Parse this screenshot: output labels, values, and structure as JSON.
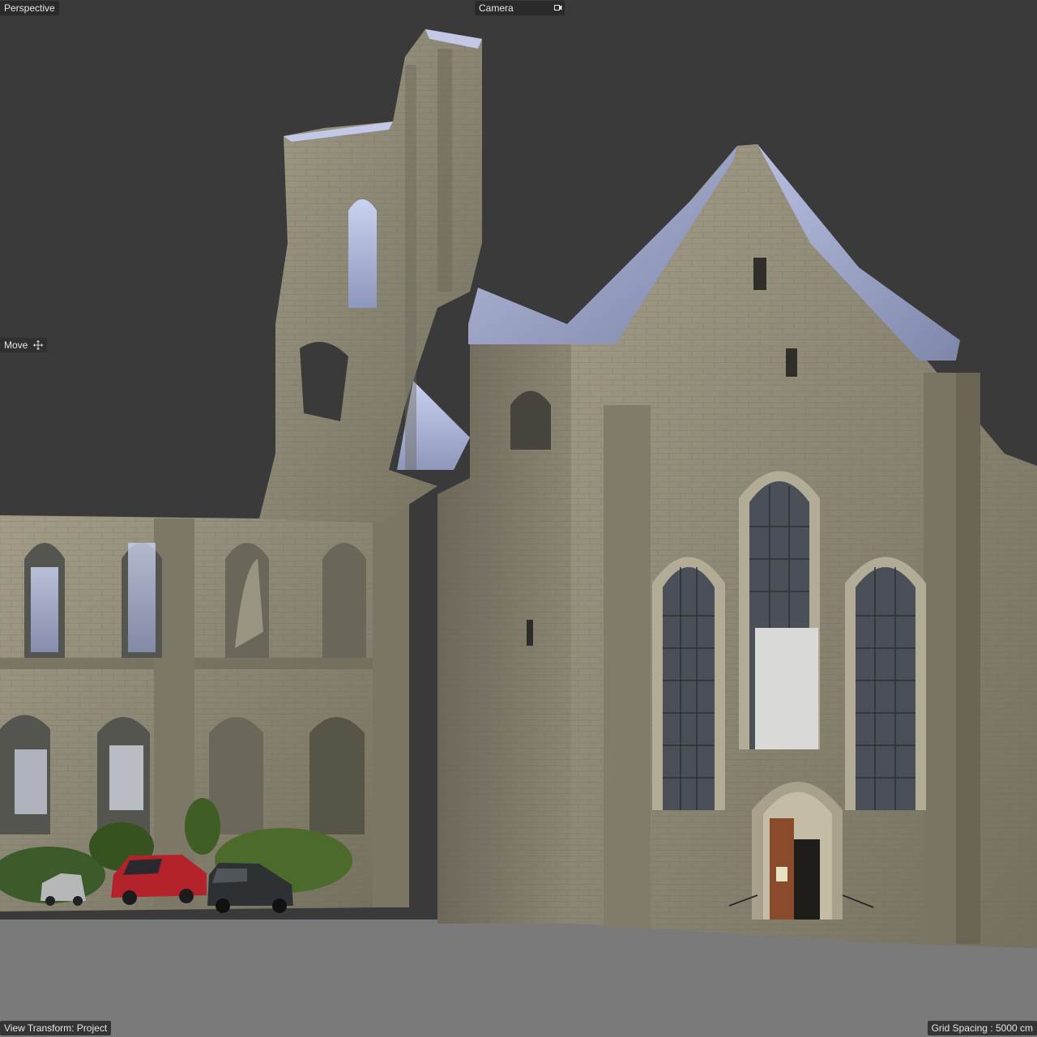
{
  "viewport": {
    "projection_label": "Perspective",
    "camera_label": "Camera",
    "camera_icon": "camera-icon",
    "tool_label": "Move",
    "tool_icon": "move-icon",
    "view_transform": "View Transform: Project",
    "grid_spacing": "Grid Spacing : 5000 cm"
  },
  "scene": {
    "subject": "photogrammetry-church-ruin",
    "colors": {
      "background": "#3a3a3a",
      "ground": "#7a7a7a",
      "stone": "#8f8a78",
      "roof": "#9ba3c8",
      "window_glass": "#4b4f58",
      "door": "#8a4a2c",
      "foliage": "#3d5a2a",
      "car_red": "#b4232c",
      "car_dark": "#2e3133",
      "car_silver": "#b5b7b8"
    }
  }
}
